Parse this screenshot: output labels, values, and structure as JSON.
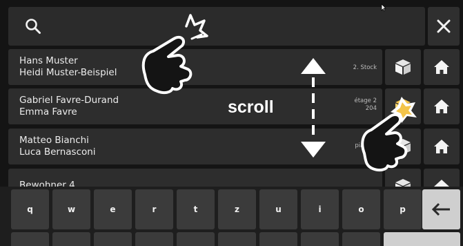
{
  "search": {
    "icon": "search-icon",
    "value": ""
  },
  "close": {
    "icon": "close-icon"
  },
  "rows": [
    {
      "line1": "Hans Muster",
      "line2": "Heidi Muster-Beispiel",
      "floor1": "2. Stock",
      "floor2": "",
      "box_icon": "package-icon",
      "home_icon": "home-icon"
    },
    {
      "line1": "Gabriel Favre-Durand",
      "line2": "Emma Favre",
      "floor1": "étage 2",
      "floor2": "204",
      "box_icon": "package-icon",
      "home_icon": "home-icon"
    },
    {
      "line1": "Matteo Bianchi",
      "line2": "Luca Bernasconi",
      "floor1": "piano 3",
      "floor2": "",
      "box_icon": "package-icon",
      "home_icon": "home-icon"
    },
    {
      "line1": "Bewohner 4",
      "line2": "",
      "floor1": "",
      "floor2": "",
      "box_icon": "package-icon",
      "home_icon": "home-icon"
    }
  ],
  "keyboard": {
    "keys": [
      "q",
      "w",
      "e",
      "r",
      "t",
      "z",
      "u",
      "i",
      "o",
      "p"
    ],
    "backspace_icon": "backspace-arrow-icon"
  },
  "overlay": {
    "scroll_label": "scroll",
    "gesture_icons": [
      "tap-hand-icon",
      "tap-hand-icon",
      "scroll-arrows-icon"
    ]
  }
}
